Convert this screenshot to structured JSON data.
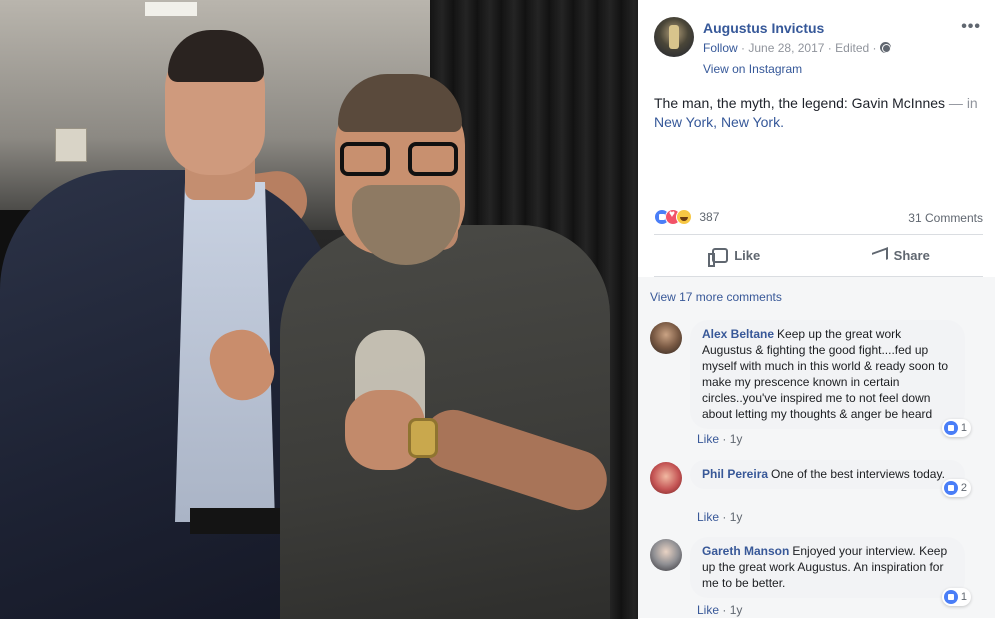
{
  "post": {
    "author": "Augustus Invictus",
    "follow": "Follow",
    "date": "June 28, 2017",
    "edited": "Edited",
    "view_on": "View on Instagram",
    "caption_text": "The man, the myth, the legend: Gavin McInnes",
    "caption_in": " — in",
    "location_city": "New York",
    "location_state": "New York",
    "reaction_count": "387",
    "comments_count": "31 Comments",
    "like_label": "Like",
    "share_label": "Share"
  },
  "comments": {
    "view_more": "View 17 more comments",
    "items": [
      {
        "name": "Alex Beltane",
        "text": "Keep up the great work Augustus & fighting the good fight....fed up myself with much in this world & ready soon to make my prescence known in certain circles..you've inspired me to not feel down about letting my thoughts & anger be heard",
        "likes": "1",
        "like_label": "Like",
        "time": "1y"
      },
      {
        "name": "Phil Pereira",
        "text": "One of the best interviews today.",
        "likes": "2",
        "like_label": "Like",
        "time": "1y"
      },
      {
        "name": "Gareth Manson",
        "text": "Enjoyed your interview. Keep up the great work Augustus. An inspiration for me to be better.",
        "likes": "1",
        "like_label": "Like",
        "time": "1y"
      }
    ]
  },
  "colors": {
    "link": "#365899",
    "muted": "#90949c",
    "like_blue": "#4a7ef7",
    "love_red": "#f25268"
  }
}
